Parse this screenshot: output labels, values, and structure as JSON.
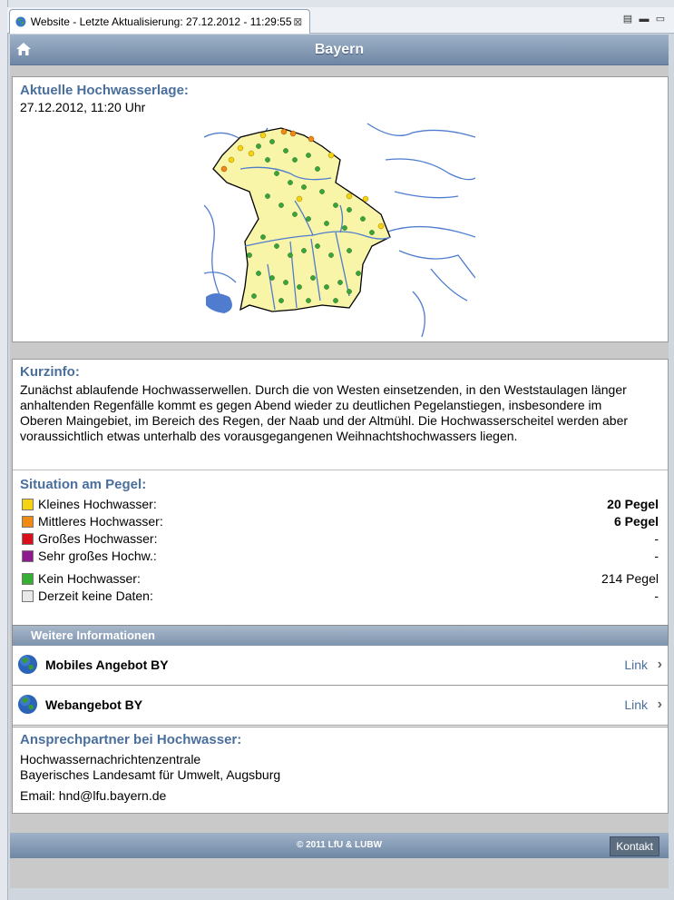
{
  "tab": {
    "title": "Website - Letzte Aktualisierung: 27.12.2012 - 11:29:55",
    "close": "⊠"
  },
  "header": {
    "title": "Bayern",
    "home_icon": "home-icon"
  },
  "lage": {
    "heading": "Aktuelle Hochwasserlage:",
    "datetime": "27.12.2012, 11:20 Uhr"
  },
  "kurzinfo": {
    "heading": "Kurzinfo:",
    "text": "Zunächst ablaufende Hochwasserwellen. Durch die von Westen einsetzenden, in den Weststaulagen länger anhaltenden Regenfälle kommt es gegen Abend wieder zu deutlichen Pegelanstiegen, insbesondere im Oberen Maingebiet, im Bereich des Regen, der Naab und der Altmühl. Die Hochwasserscheitel werden aber voraussichtlich etwas unterhalb des vorausgegangenen Weihnachtshochwassers liegen."
  },
  "situation": {
    "heading": "Situation am Pegel:",
    "rows": [
      {
        "label": "Kleines Hochwasser:",
        "value": "20 Pegel",
        "color": "#f5d312",
        "bold": true
      },
      {
        "label": "Mittleres Hochwasser:",
        "value": "6 Pegel",
        "color": "#f08a12",
        "bold": true
      },
      {
        "label": "Großes Hochwasser:",
        "value": "-",
        "color": "#d8101a",
        "bold": false
      },
      {
        "label": "Sehr großes Hochw.:",
        "value": "-",
        "color": "#8e1a8e",
        "bold": false
      },
      {
        "label": "Kein Hochwasser:",
        "value": "214 Pegel",
        "color": "#35b035",
        "bold": false
      },
      {
        "label": "Derzeit keine Daten:",
        "value": "-",
        "color": "#e8e8e8",
        "bold": false
      }
    ]
  },
  "weitere": {
    "heading": "Weitere Informationen"
  },
  "links": [
    {
      "title": "Mobiles Angebot BY",
      "link": "Link"
    },
    {
      "title": "Webangebot BY",
      "link": "Link"
    }
  ],
  "kontakt": {
    "heading": "Ansprechpartner bei Hochwasser:",
    "line1": "Hochwassernachrichtenzentrale",
    "line2": "Bayerisches Landesamt für Umwelt, Augsburg",
    "email": "Email: hnd@lfu.bayern.de"
  },
  "footer": {
    "copyright": "© 2011 LfU & LUBW",
    "kontakt_button": "Kontakt"
  },
  "colors": {
    "accent": "#4a6f9c",
    "header": "#7f95b0"
  }
}
